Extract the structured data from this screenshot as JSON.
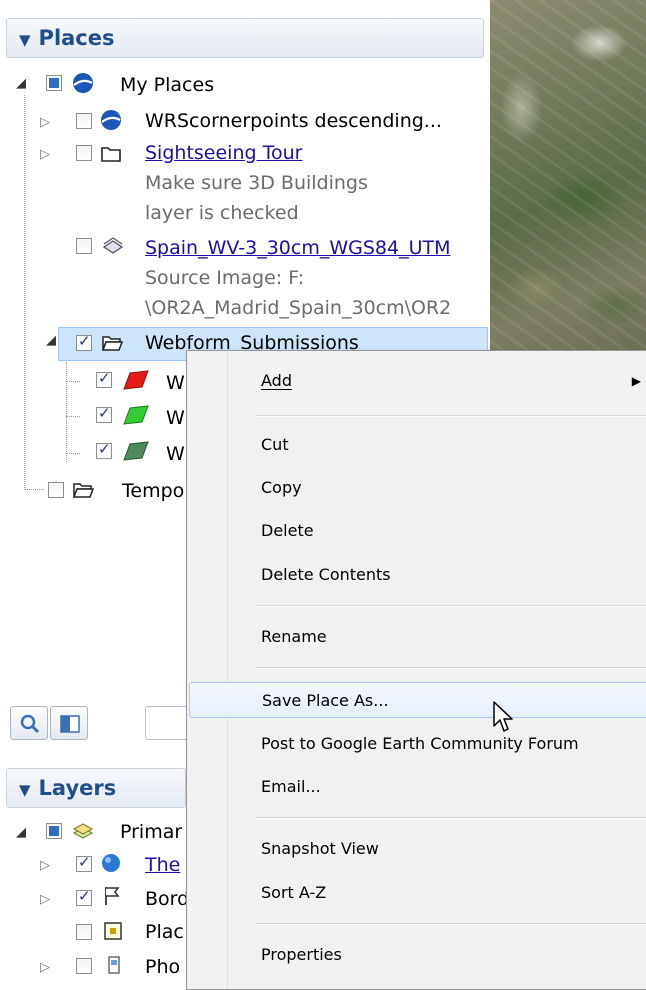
{
  "places": {
    "header": "Places",
    "root": "My Places",
    "items": [
      {
        "label": "WRScornerpoints descending..."
      },
      {
        "label": "Sightseeing Tour",
        "desc": [
          "Make sure 3D Buildings",
          "layer is checked"
        ]
      },
      {
        "label": "Spain_WV-3_30cm_WGS84_UTM",
        "desc": [
          "Source Image: F:",
          "\\OR2A_Madrid_Spain_30cm\\OR2"
        ]
      },
      {
        "label": "Webform_Submissions"
      }
    ],
    "sub_items": [
      "W",
      "W",
      "W"
    ],
    "temp": "Tempo"
  },
  "layers": {
    "header": "Layers",
    "items": [
      "Primar",
      "The",
      "Bord",
      "Plac",
      "Pho"
    ]
  },
  "context_menu": {
    "items": [
      "Add",
      "Cut",
      "Copy",
      "Delete",
      "Delete Contents",
      "Rename",
      "Save Place As...",
      "Post to Google Earth Community Forum",
      "Email...",
      "Snapshot View",
      "Sort A-Z",
      "Properties"
    ],
    "submenu_arrow": "▶"
  },
  "icons": {
    "collapse": "◢",
    "expand": "▷",
    "header_triangle": "▼"
  },
  "colors": {
    "selection": "#cde4fa",
    "link": "#1a0dab",
    "header_text": "#1f4e8c",
    "polygon_red": "#e51b1b",
    "polygon_green": "#33cc33",
    "polygon_darkgreen": "#4f8a5e"
  }
}
